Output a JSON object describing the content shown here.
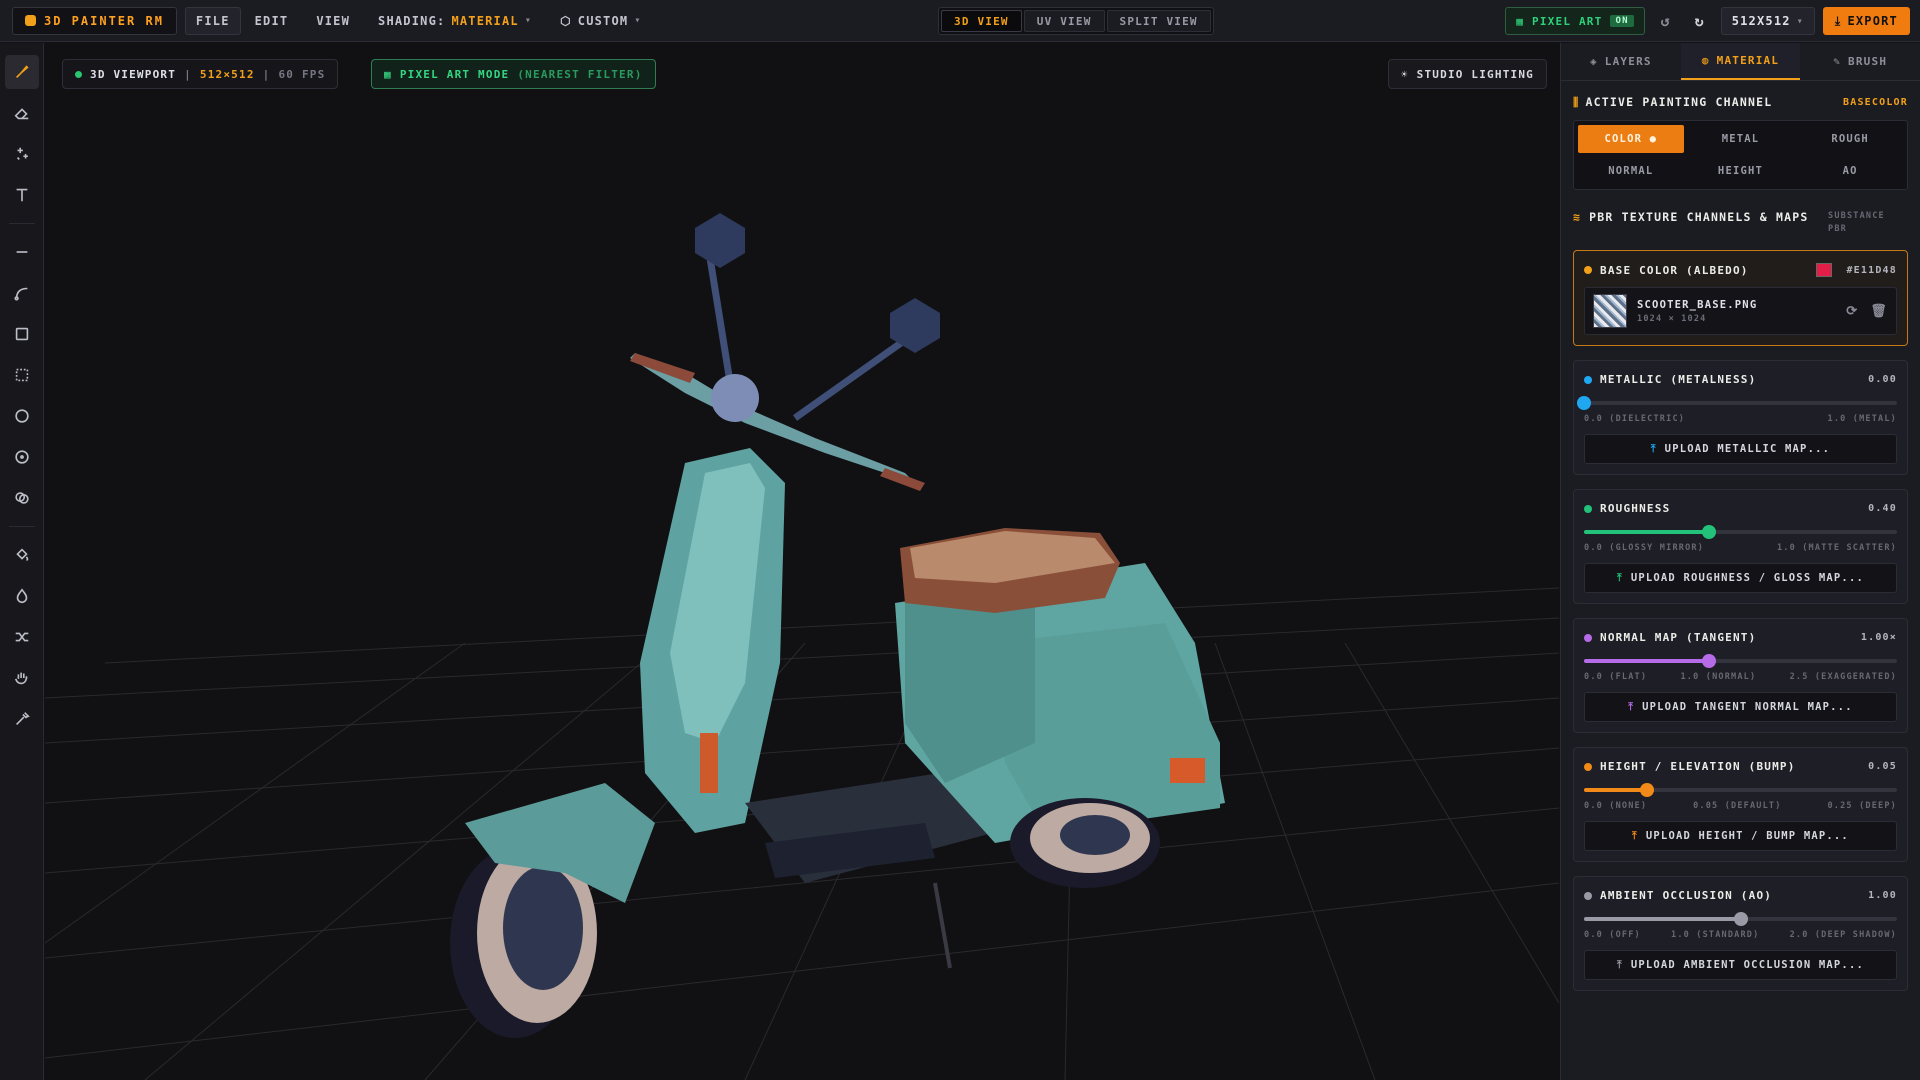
{
  "app": {
    "title": "3D PAINTER RM"
  },
  "menu": {
    "file": "FILE",
    "edit": "EDIT",
    "view": "VIEW",
    "shading_label": "SHADING:",
    "shading_value": "MATERIAL",
    "custom": "CUSTOM"
  },
  "view_tabs": [
    "3D VIEW",
    "UV VIEW",
    "SPLIT VIEW"
  ],
  "top_right": {
    "pixel_art": "PIXEL ART",
    "pixel_art_state": "ON",
    "size": "512X512",
    "export": "EXPORT"
  },
  "viewport": {
    "title": "3D VIEWPORT",
    "resolution": "512×512",
    "fps": "60 FPS",
    "pixel_mode": "PIXEL ART MODE",
    "pixel_mode_sub": "(NEAREST FILTER)",
    "lighting": "STUDIO LIGHTING"
  },
  "sidebar": {
    "tabs": [
      "LAYERS",
      "MATERIAL",
      "BRUSH"
    ],
    "active_channel_title": "ACTIVE PAINTING CHANNEL",
    "active_channel_value": "BASECOLOR",
    "channels": [
      "COLOR ●",
      "METAL",
      "ROUGH",
      "NORMAL",
      "HEIGHT",
      "AO"
    ],
    "pbr_title": "PBR TEXTURE CHANNELS & MAPS",
    "pbr_sub": "SUBSTANCE PBR",
    "base": {
      "title": "BASE COLOR (ALBEDO)",
      "hex": "#E11D48",
      "file": "SCOOTER_BASE.PNG",
      "dims": "1024 × 1024"
    },
    "metallic": {
      "title": "METALLIC (METALNESS)",
      "value": "0.00",
      "fraction": 0.0,
      "min": "0.0 (DIELECTRIC)",
      "max": "1.0 (METAL)",
      "upload": "UPLOAD METALLIC MAP..."
    },
    "roughness": {
      "title": "ROUGHNESS",
      "value": "0.40",
      "fraction": 0.4,
      "min": "0.0 (GLOSSY MIRROR)",
      "max": "1.0 (MATTE SCATTER)",
      "upload": "UPLOAD ROUGHNESS / GLOSS MAP..."
    },
    "normal": {
      "title": "NORMAL MAP (TANGENT)",
      "value": "1.00×",
      "fraction": 0.4,
      "min": "0.0 (FLAT)",
      "mid": "1.0 (NORMAL)",
      "max": "2.5 (EXAGGERATED)",
      "upload": "UPLOAD TANGENT NORMAL MAP..."
    },
    "height": {
      "title": "HEIGHT / ELEVATION (BUMP)",
      "value": "0.05",
      "fraction": 0.2,
      "min": "0.0 (NONE)",
      "mid": "0.05 (DEFAULT)",
      "max": "0.25 (DEEP)",
      "upload": "UPLOAD HEIGHT / BUMP MAP..."
    },
    "ao": {
      "title": "AMBIENT OCCLUSION (AO)",
      "value": "1.00",
      "fraction": 0.5,
      "min": "0.0 (OFF)",
      "mid": "1.0 (STANDARD)",
      "max": "2.0 (DEEP SHADOW)",
      "upload": "UPLOAD AMBIENT OCCLUSION MAP..."
    }
  },
  "colors": {
    "accent": "#F2A019",
    "metallic": "#1FA8F0",
    "roughness": "#22C27A",
    "normal": "#B66BE8",
    "height": "#F28A1A",
    "ao": "#9A9AA6",
    "base": "#E11D48"
  }
}
